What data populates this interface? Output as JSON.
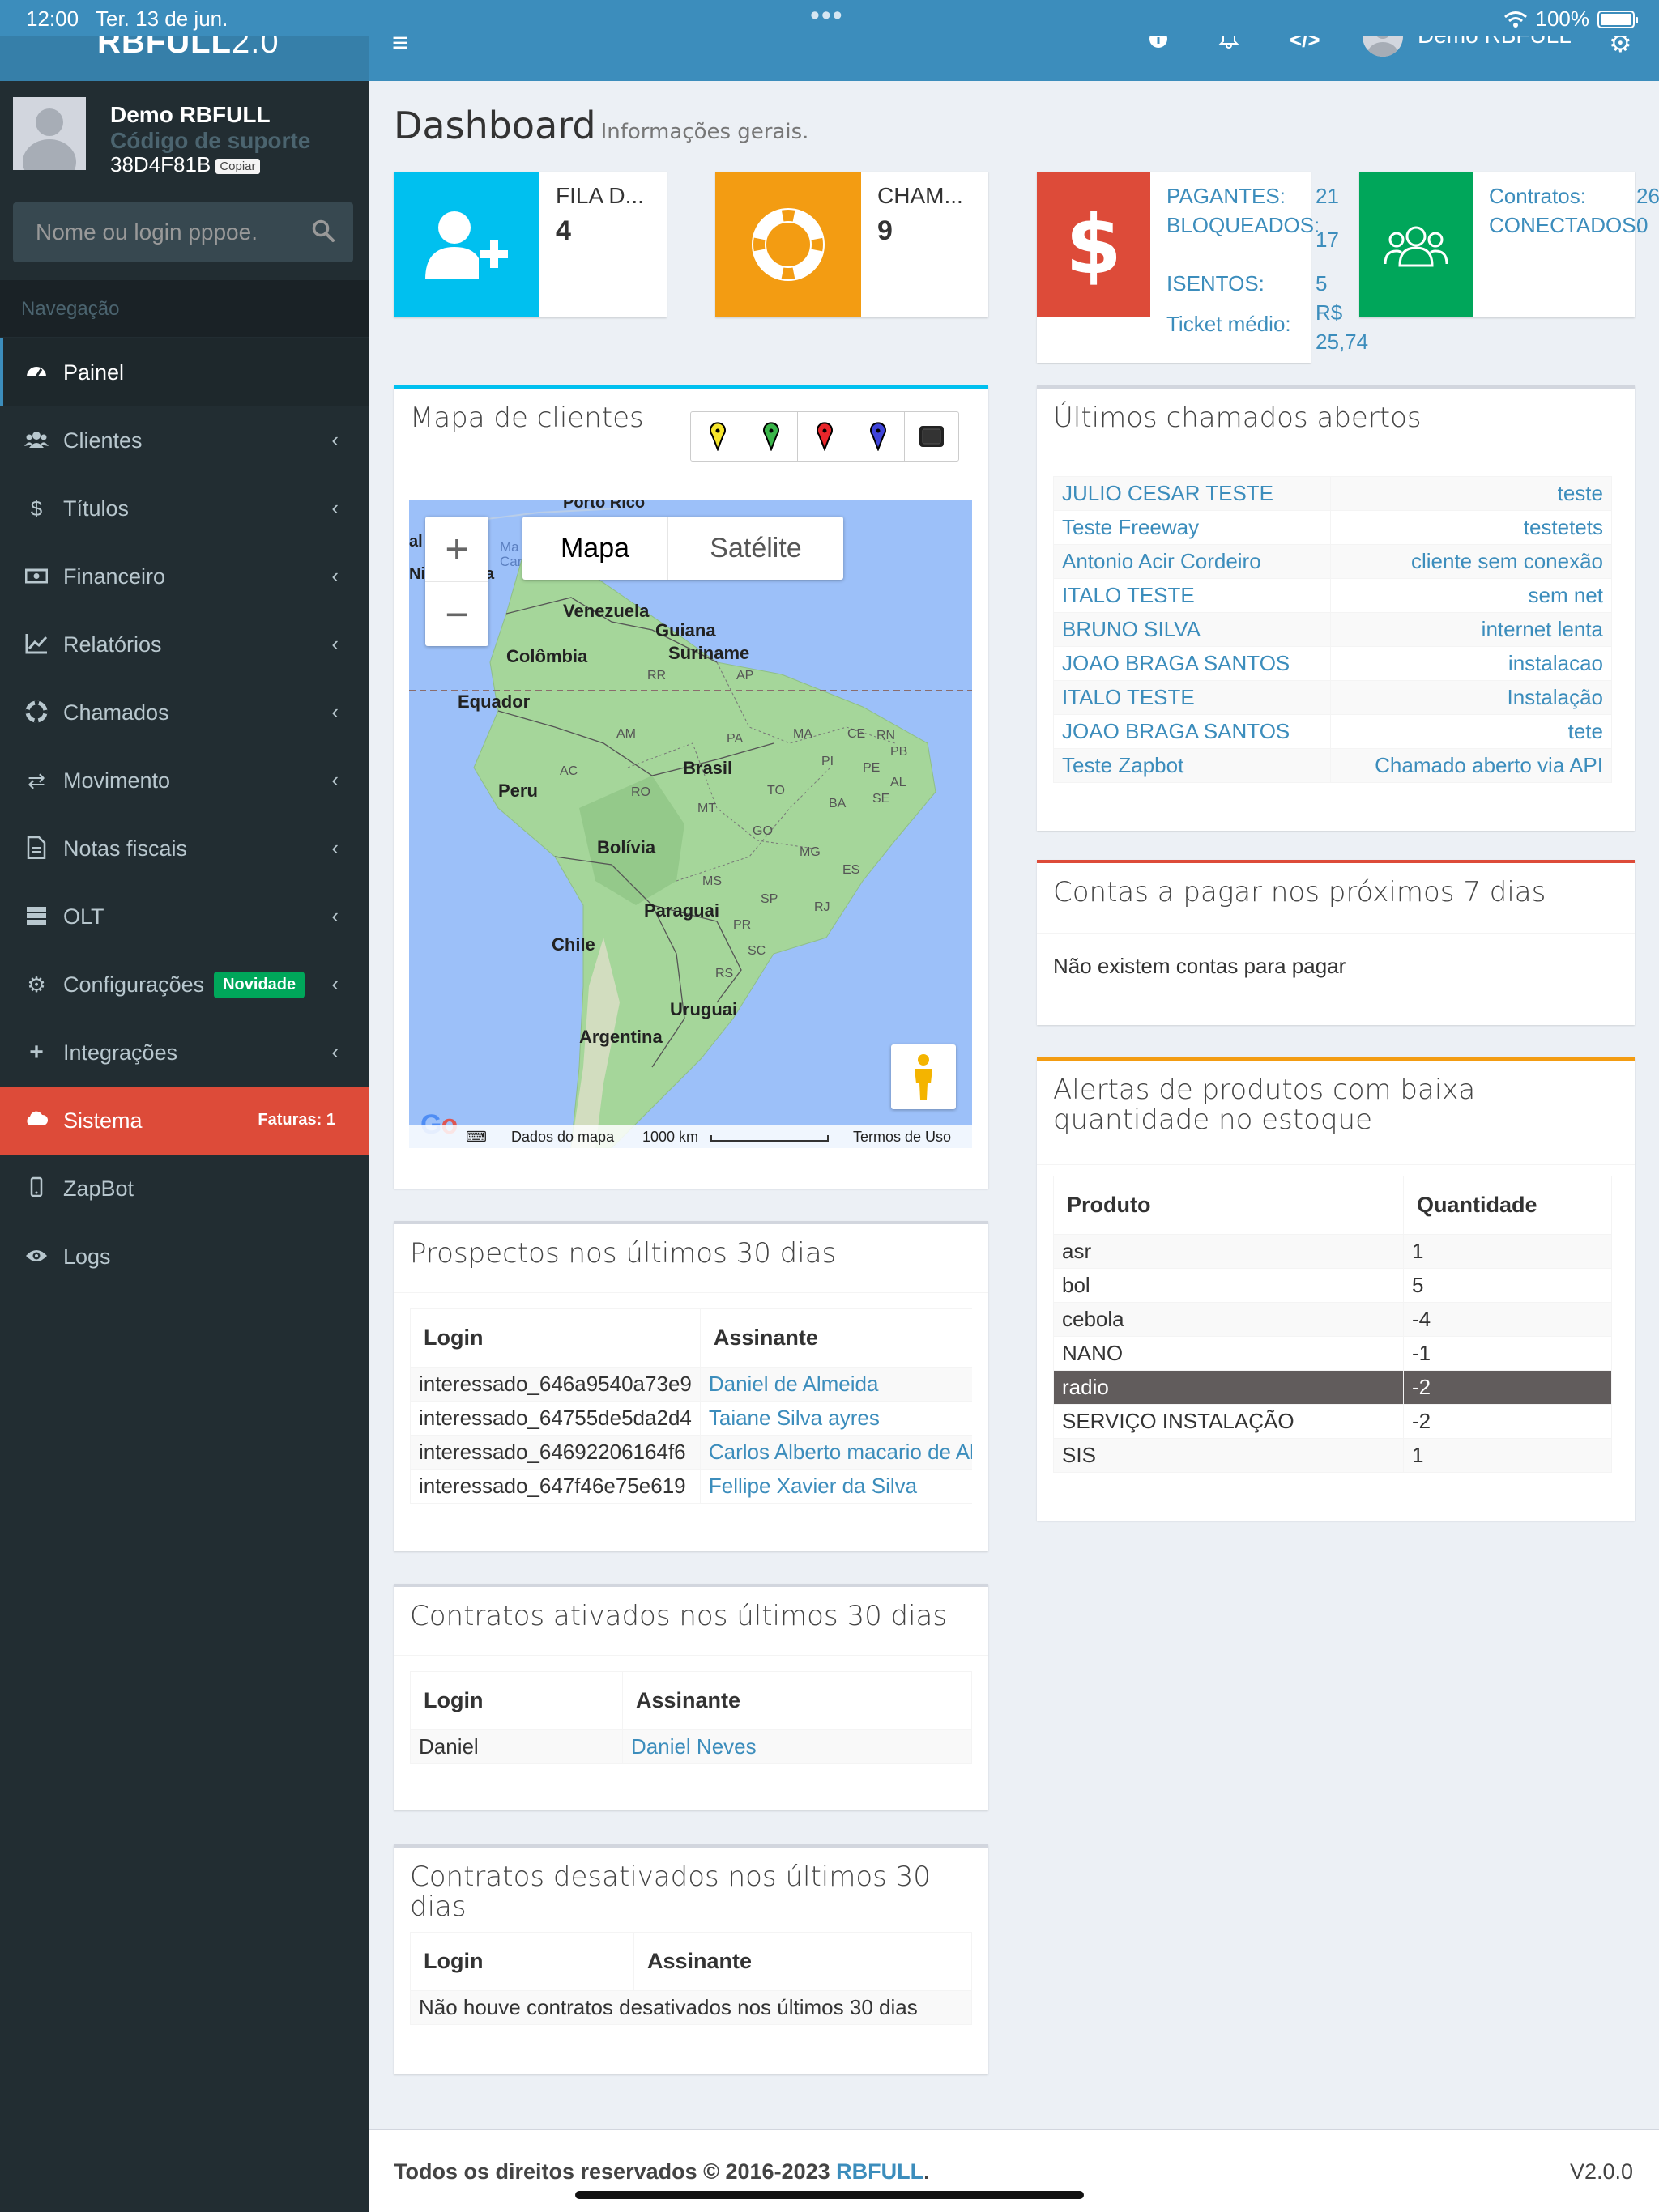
{
  "statusbar": {
    "time": "12:00",
    "date": "Ter. 13 de jun.",
    "battery": "100%"
  },
  "brand": {
    "bold": "RBFULL",
    "light": "2.0"
  },
  "header": {
    "user_name": "Demo RBFULL"
  },
  "user_panel": {
    "name": "Demo RBFULL",
    "support_label": "Código de suporte",
    "support_code": "38D4F81B",
    "copy_label": "Copiar"
  },
  "search": {
    "placeholder": "Nome ou login pppoe."
  },
  "nav_header": "Navegação",
  "nav": [
    {
      "label": "Painel",
      "icon": "dashboard-icon"
    },
    {
      "label": "Clientes",
      "icon": "users-icon"
    },
    {
      "label": "Títulos",
      "icon": "dollar-icon"
    },
    {
      "label": "Financeiro",
      "icon": "money-icon"
    },
    {
      "label": "Relatórios",
      "icon": "chart-icon"
    },
    {
      "label": "Chamados",
      "icon": "lifebuoy-icon"
    },
    {
      "label": "Movimento",
      "icon": "exchange-icon"
    },
    {
      "label": "Notas fiscais",
      "icon": "file-icon"
    },
    {
      "label": "OLT",
      "icon": "server-icon"
    },
    {
      "label": "Configurações",
      "icon": "gears-icon",
      "badge": "Novidade"
    },
    {
      "label": "Integrações",
      "icon": "plus-icon"
    },
    {
      "label": "Sistema",
      "icon": "cloud-icon",
      "badge": "Faturas: 1"
    },
    {
      "label": "ZapBot",
      "icon": "mobile-icon"
    },
    {
      "label": "Logs",
      "icon": "eye-icon"
    }
  ],
  "page": {
    "title": "Dashboard",
    "subtitle": "Informações gerais."
  },
  "infoboxes": {
    "fila": {
      "label": "FILA D...",
      "value": "4",
      "color": "#00c0ef"
    },
    "chamados": {
      "label": "CHAM...",
      "value": "9",
      "color": "#f39c12"
    },
    "financeiro": {
      "color": "#dd4b39",
      "pagantes_label": "PAGANTES:",
      "pagantes": "21",
      "bloqueados_label": "BLOQUEADOS:",
      "bloqueados": "17",
      "isentos_label": "ISENTOS:",
      "isentos": "5",
      "ticket_label": "Ticket médio:",
      "ticket_cur": "R$",
      "ticket": "25,74"
    },
    "contratos": {
      "color": "#00a65a",
      "contratos_label": "Contratos:",
      "contratos": "26",
      "conectados_label": "CONECTADOS:",
      "conectados": "0"
    }
  },
  "map_box": {
    "title": "Mapa de clientes",
    "btn_map": "Mapa",
    "btn_sat": "Satélite",
    "attribution": "Dados do mapa",
    "scale": "1000 km",
    "terms": "Termos de Uso",
    "labels": {
      "porto_rico": "Porto Rico",
      "venezuela": "Venezuela",
      "guiana": "Guiana",
      "suriname": "Suriname",
      "colombia": "Colômbia",
      "equador": "Equador",
      "peru": "Peru",
      "brasil": "Brasil",
      "bolivia": "Bolívia",
      "paraguai": "Paraguai",
      "chile": "Chile",
      "uruguai": "Uruguai",
      "argentina": "Argentina",
      "rr": "RR",
      "ap": "AP",
      "am": "AM",
      "pa": "PA",
      "ma": "MA",
      "ce": "CE",
      "rn": "RN",
      "pb": "PB",
      "pi": "PI",
      "pe": "PE",
      "al": "AL",
      "se": "SE",
      "ac": "AC",
      "ro": "RO",
      "to": "TO",
      "ba": "BA",
      "mt": "MT",
      "go": "GO",
      "mg": "MG",
      "es": "ES",
      "ms": "MS",
      "sp": "SP",
      "rj": "RJ",
      "pr": "PR",
      "sc": "SC",
      "rs": "RS",
      "edge1": "al",
      "edge2": "Ni",
      "edge3": "a",
      "edge4": "Ma",
      "edge5": "Car"
    }
  },
  "chamados_box": {
    "title": "Últimos chamados abertos",
    "rows": [
      {
        "name": "JULIO CESAR TESTE",
        "subject": "teste"
      },
      {
        "name": "Teste Freeway",
        "subject": "testetets"
      },
      {
        "name": "Antonio Acir Cordeiro",
        "subject": "cliente sem conexão"
      },
      {
        "name": "ITALO TESTE",
        "subject": "sem net"
      },
      {
        "name": "BRUNO SILVA",
        "subject": "internet lenta"
      },
      {
        "name": "JOAO BRAGA SANTOS",
        "subject": "instalacao"
      },
      {
        "name": "ITALO TESTE",
        "subject": "Instalação"
      },
      {
        "name": "JOAO BRAGA SANTOS",
        "subject": "tete"
      },
      {
        "name": "Teste Zapbot",
        "subject": "Chamado aberto via API"
      }
    ]
  },
  "contas_box": {
    "title": "Contas a pagar nos próximos 7 dias",
    "empty": "Não existem contas para pagar"
  },
  "estoque_box": {
    "title": "Alertas de produtos com baixa quantidade no estoque",
    "col_produto": "Produto",
    "col_qtd": "Quantidade",
    "rows": [
      {
        "produto": "asr",
        "qtd": "1"
      },
      {
        "produto": "bol",
        "qtd": "5"
      },
      {
        "produto": "cebola",
        "qtd": "-4"
      },
      {
        "produto": "NANO",
        "qtd": "-1"
      },
      {
        "produto": "radio",
        "qtd": "-2"
      },
      {
        "produto": "SERVIÇO INSTALAÇÃO",
        "qtd": "-2"
      },
      {
        "produto": "SIS",
        "qtd": "1"
      }
    ]
  },
  "prospectos_box": {
    "title": "Prospectos nos últimos 30 dias",
    "col_login": "Login",
    "col_assinante": "Assinante",
    "rows": [
      {
        "login": "interessado_646a9540a73e9",
        "assinante": "Daniel de Almeida"
      },
      {
        "login": "interessado_64755de5da2d4",
        "assinante": "Taiane Silva ayres"
      },
      {
        "login": "interessado_64692206164f6",
        "assinante": "Carlos Alberto macario de Al"
      },
      {
        "login": "interessado_647f46e75e619",
        "assinante": "Fellipe Xavier da Silva"
      }
    ]
  },
  "ativados_box": {
    "title": "Contratos ativados nos últimos 30 dias",
    "col_login": "Login",
    "col_assinante": "Assinante",
    "rows": [
      {
        "login": "Daniel",
        "assinante": "Daniel Neves"
      }
    ]
  },
  "desativados_box": {
    "title": "Contratos desativados nos últimos 30 dias",
    "col_login": "Login",
    "col_assinante": "Assinante",
    "empty": "Não houve contratos desativados nos últimos 30 dias"
  },
  "footer": {
    "copyright": "Todos os direitos reservados © 2016-2023",
    "brand": "RBFULL",
    "dot": ".",
    "version": "V2.0.0"
  }
}
